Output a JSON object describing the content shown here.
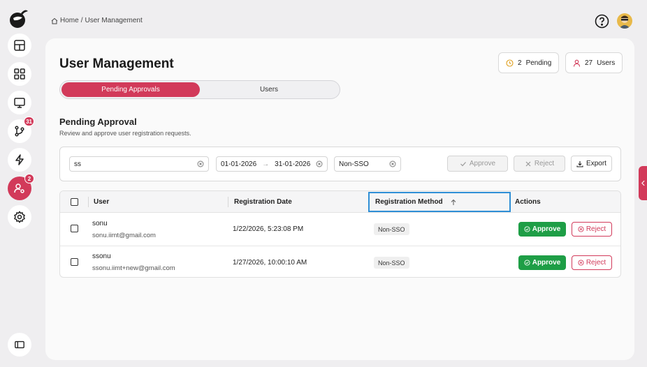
{
  "breadcrumb": {
    "home": "Home",
    "separator": "/",
    "current": "User Management"
  },
  "sidebar": {
    "items": [
      {
        "name": "dashboard",
        "icon": "layout-icon",
        "badge": null,
        "active": false
      },
      {
        "name": "apps",
        "icon": "grid-icon",
        "badge": null,
        "active": false
      },
      {
        "name": "monitor",
        "icon": "monitor-icon",
        "badge": null,
        "active": false
      },
      {
        "name": "workflows",
        "icon": "branch-icon",
        "badge": "31",
        "active": false
      },
      {
        "name": "automation",
        "icon": "lightning-icon",
        "badge": null,
        "active": false
      },
      {
        "name": "user-management",
        "icon": "user-gear-icon",
        "badge": "2",
        "active": true
      },
      {
        "name": "settings",
        "icon": "gear-icon",
        "badge": null,
        "active": false
      }
    ]
  },
  "header": {
    "title": "User Management"
  },
  "stats": {
    "pending_count": "2",
    "pending_label": "Pending",
    "users_count": "27",
    "users_label": "Users"
  },
  "tabs": [
    {
      "label": "Pending Approvals",
      "active": true
    },
    {
      "label": "Users",
      "active": false
    }
  ],
  "section": {
    "title": "Pending Approval",
    "subtitle": "Review and approve user registration requests."
  },
  "filters": {
    "search_value": "ss",
    "date_from": "01-01-2026",
    "date_arrow": "→",
    "date_to": "31-01-2026",
    "method_value": "Non-SSO",
    "approve_label": "Approve",
    "reject_label": "Reject",
    "export_label": "Export"
  },
  "table": {
    "columns": [
      "User",
      "Registration Date",
      "Registration Method",
      "Actions"
    ],
    "sorted_column": "Registration Method",
    "rows": [
      {
        "name": "sonu",
        "email": "sonu.iimt@gmail.com",
        "date": "1/22/2026, 5:23:08 PM",
        "method": "Non-SSO",
        "approve": "Approve",
        "reject": "Reject"
      },
      {
        "name": "ssonu",
        "email": "ssonu.iimt+new@gmail.com",
        "date": "1/27/2026, 10:00:10 AM",
        "method": "Non-SSO",
        "approve": "Approve",
        "reject": "Reject"
      }
    ]
  },
  "colors": {
    "accent": "#d23a5a",
    "approve": "#1e9e46",
    "sort_highlight": "#2f8fd6"
  }
}
